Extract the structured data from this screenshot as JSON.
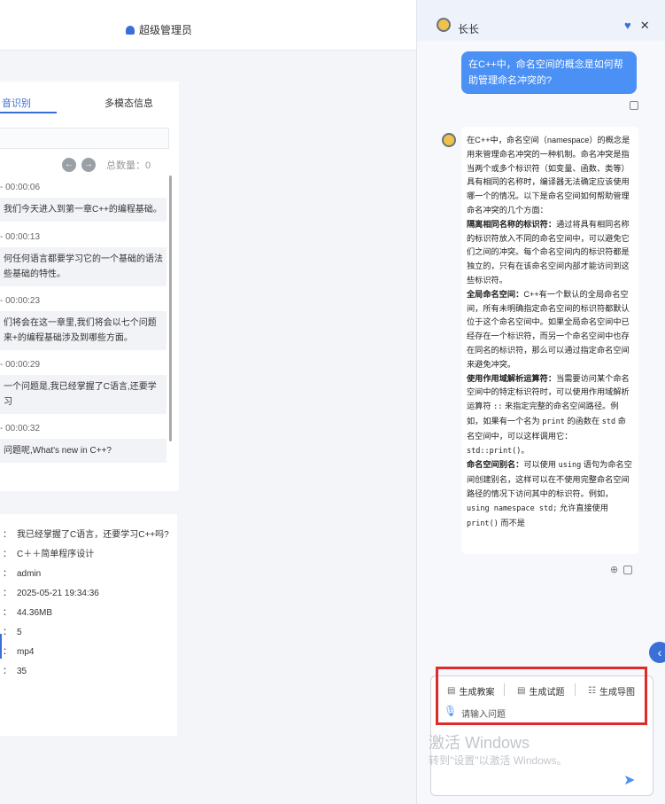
{
  "header": {
    "user": "超级管理员"
  },
  "tabs": [
    "音识别",
    "多模态信息"
  ],
  "pager": {
    "total_label": "总数量：0"
  },
  "segments": [
    {
      "time": "- 00:00:06",
      "text": "我们今天进入到第一章C++的编程基础。"
    },
    {
      "time": "- 00:00:13",
      "text": "何任何语言都要学习它的一个基础的语法些基础的特性。"
    },
    {
      "time": "- 00:00:23",
      "text": "们将会在这一章里,我们将会以七个问题来+的编程基础涉及到哪些方面。"
    },
    {
      "time": "- 00:00:29",
      "text": "一个问题是,我已经掌握了C语言,还要学习"
    },
    {
      "time": "- 00:00:32",
      "text": "问题呢,What's new in C++?"
    }
  ],
  "info": [
    "我已经掌握了C语言，还要学习C++吗?",
    "C＋＋简单程序设计",
    "admin",
    "2025-05-21 19:34:36",
    "44.36MB",
    "5",
    "mp4",
    "35"
  ],
  "chat": {
    "bot_name": "长长",
    "question": "在C++中，命名空间的概念是如何帮助管理命名冲突的?",
    "answer_intro": "在C++中，命名空间（namespace）的概念是用来管理命名冲突的一种机制。命名冲突是指当两个或多个标识符（如变量、函数、类等）具有相同的名称时，编译器无法确定应该使用哪一个的情况。以下是命名空间如何帮助管理命名冲突的几个方面：",
    "p1_title": "隔离相同名称的标识符：",
    "p1_text": "通过将具有相同名称的标识符放入不同的命名空间中，可以避免它们之间的冲突。每个命名空间内的标识符都是独立的，只有在该命名空间内部才能访问到这些标识符。",
    "p2_title": "全局命名空间：",
    "p2_text": "C++有一个默认的全局命名空间，所有未明确指定命名空间的标识符都默认位于这个命名空间中。如果全局命名空间中已经存在一个标识符，而另一个命名空间中也存在同名的标识符，那么可以通过指定命名空间来避免冲突。",
    "p3_title": "使用作用域解析运算符：",
    "p3_text_a": "当需要访问某个命名空间中的特定标识符时，可以使用作用域解析运算符",
    "p3_code1": "::",
    "p3_text_b": "来指定完整的命名空间路径。例如，如果有一个名为",
    "p3_code2": "print",
    "p3_text_c": "的函数在",
    "p3_code3": "std",
    "p3_text_d": "命名空间中，可以这样调用它：",
    "p3_code4": "std::print()",
    "p3_text_e": "。",
    "p4_title": "命名空间别名：",
    "p4_text_a": "可以使用",
    "p4_code1": "using",
    "p4_text_b": "语句为命名空间创建别名，这样可以在不使用完整命名空间路径的情况下访问其中的标识符。例如，",
    "p4_code2": "using namespace std;",
    "p4_text_c": "允许直接使用",
    "p4_code3": "print()",
    "p4_text_d": "而不是",
    "actions": [
      "生成教案",
      "生成试题",
      "生成导图"
    ],
    "input_placeholder": "请输入问题",
    "watermark_line1": "激活 Windows",
    "watermark_line2": "转到\"设置\"以激活 Windows。"
  },
  "colors": {
    "accent": "#3b6fd8",
    "bubble": "#4a90f5",
    "highlight": "#e02b2b"
  }
}
